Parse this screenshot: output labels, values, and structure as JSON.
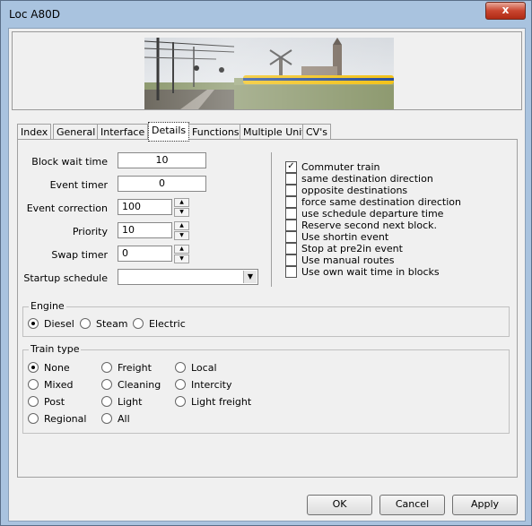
{
  "window": {
    "title": "Loc A80D",
    "close_glyph": "x"
  },
  "tabs": [
    "Index",
    "General",
    "Interface",
    "Details",
    "Functions",
    "Multiple Unit",
    "CV's"
  ],
  "details": {
    "block_wait_time": {
      "label": "Block wait time",
      "value": "10"
    },
    "event_timer": {
      "label": "Event timer",
      "value": "0"
    },
    "event_correction": {
      "label": "Event correction",
      "value": "100"
    },
    "priority": {
      "label": "Priority",
      "value": "10"
    },
    "swap_timer": {
      "label": "Swap timer",
      "value": "0"
    },
    "startup_schedule": {
      "label": "Startup schedule",
      "value": ""
    }
  },
  "options": [
    {
      "label": "Commuter train",
      "checked": true
    },
    {
      "label": "same destination direction",
      "checked": false
    },
    {
      "label": "opposite destinations",
      "checked": false
    },
    {
      "label": "force same destination direction",
      "checked": false
    },
    {
      "label": "use schedule departure time",
      "checked": false
    },
    {
      "label": "Reserve second next block.",
      "checked": false
    },
    {
      "label": "Use shortin event",
      "checked": false
    },
    {
      "label": "Stop at pre2in event",
      "checked": false
    },
    {
      "label": "Use manual routes",
      "checked": false
    },
    {
      "label": "Use own wait time in blocks",
      "checked": false
    }
  ],
  "engine": {
    "title": "Engine",
    "options": [
      "Diesel",
      "Steam",
      "Electric"
    ],
    "selected": "Diesel"
  },
  "train_type": {
    "title": "Train type",
    "options": [
      "None",
      "Mixed",
      "Post",
      "Regional",
      "Freight",
      "Cleaning",
      "Light",
      "All",
      "Local",
      "Intercity",
      "Light freight"
    ],
    "selected": "None"
  },
  "buttons": {
    "ok": "OK",
    "cancel": "Cancel",
    "apply": "Apply"
  },
  "colors": {
    "title_bar": "#a9c3df",
    "close_button": "#c9452f",
    "dialog_bg": "#f0f0f0"
  }
}
